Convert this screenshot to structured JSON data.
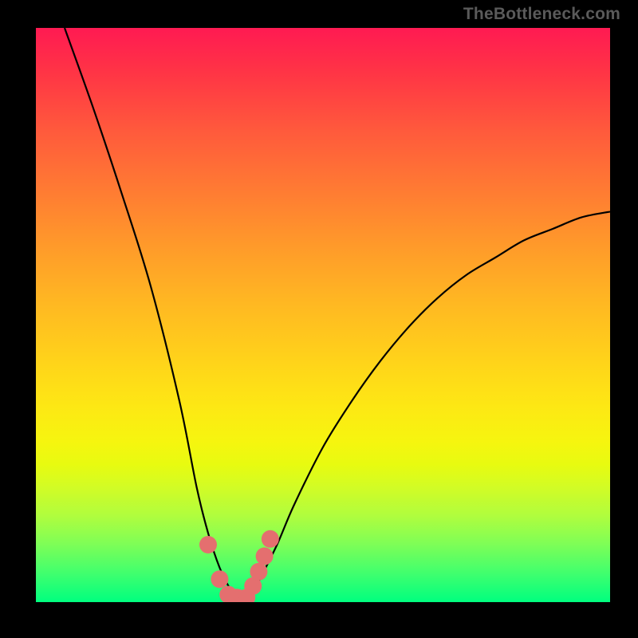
{
  "watermark": "TheBottleneck.com",
  "chart_data": {
    "type": "line",
    "title": "",
    "xlabel": "",
    "ylabel": "",
    "xlim": [
      0,
      100
    ],
    "ylim": [
      0,
      100
    ],
    "series": [
      {
        "name": "bottleneck-curve",
        "x": [
          5,
          10,
          15,
          20,
          25,
          28,
          30,
          32,
          34,
          35,
          36,
          37,
          38,
          39,
          42,
          45,
          50,
          55,
          60,
          65,
          70,
          75,
          80,
          85,
          90,
          95,
          100
        ],
        "y": [
          100,
          86,
          71,
          55,
          35,
          20,
          12,
          6,
          2,
          1,
          1,
          1,
          2,
          4,
          10,
          17,
          27,
          35,
          42,
          48,
          53,
          57,
          60,
          63,
          65,
          67,
          68
        ]
      }
    ],
    "markers": {
      "name": "highlight-points",
      "color": "#e46f6f",
      "x": [
        30,
        32,
        33.5,
        35,
        36.7,
        37.8,
        38.8,
        39.8,
        40.8
      ],
      "y": [
        10,
        4,
        1.3,
        0.8,
        0.8,
        2.8,
        5.3,
        8,
        11
      ]
    }
  }
}
